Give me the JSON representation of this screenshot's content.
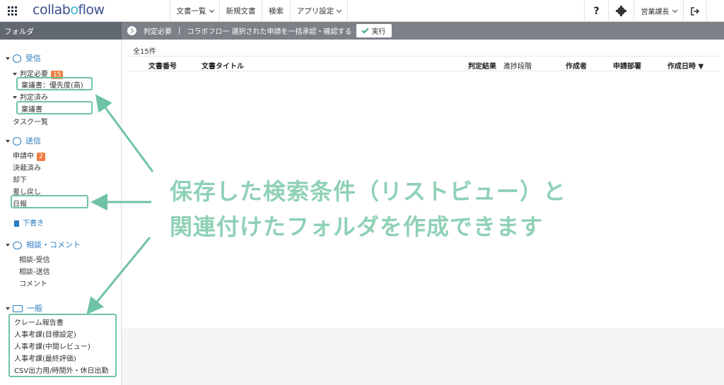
{
  "header": {
    "logo_main": "collab",
    "logo_accent": "o",
    "logo_tail": "flow",
    "nav": [
      {
        "label": "文書一覧",
        "dropdown": true
      },
      {
        "label": "新規文書",
        "dropdown": false
      },
      {
        "label": "検索",
        "dropdown": false
      },
      {
        "label": "アプリ設定",
        "dropdown": true
      }
    ],
    "help": "?",
    "user": "営業課長"
  },
  "sidebar": {
    "title": "フォルダ",
    "inbox": {
      "label": "受信",
      "needs_decision": "判定必要",
      "needs_decision_count": "15",
      "needs_decision_sub": "稟議書：優先度(高)",
      "decided": "判定済み",
      "decided_sub": "稟議書",
      "tasks": "タスク一覧"
    },
    "sent": {
      "label": "送信",
      "applying": "申請中",
      "applying_count": "2",
      "approved": "決裁済み",
      "rejected": "却下",
      "returned": "差し戻し",
      "daily": "日報"
    },
    "drafts": "下書き",
    "consult": {
      "label": "相談・コメント",
      "received": "相談-受信",
      "sent": "相談-送信",
      "comment": "コメント"
    },
    "general": {
      "label": "一般",
      "items": [
        "クレーム報告書",
        "人事考課(目標設定)",
        "人事考課(中間レビュー)",
        "人事考課(最終評価)",
        "CSV出力用/時間外・休日出勤"
      ]
    }
  },
  "actionbar": {
    "folder": "判定必要",
    "separator": "|",
    "message": "コラボフロー 選択された申請を一括承認・確認する",
    "execute": "実行"
  },
  "main": {
    "count": "全15件",
    "columns": [
      "文書番号",
      "文書タイトル",
      "判定結果",
      "進捗段階",
      "作成者",
      "申請部署",
      "作成日時 ▼"
    ]
  },
  "overlay": {
    "line1": "保存した検索条件（リストビュー）と",
    "line2": "関連付けたフォルダを作成できます",
    "highlight_color": "#6fc3a5"
  }
}
